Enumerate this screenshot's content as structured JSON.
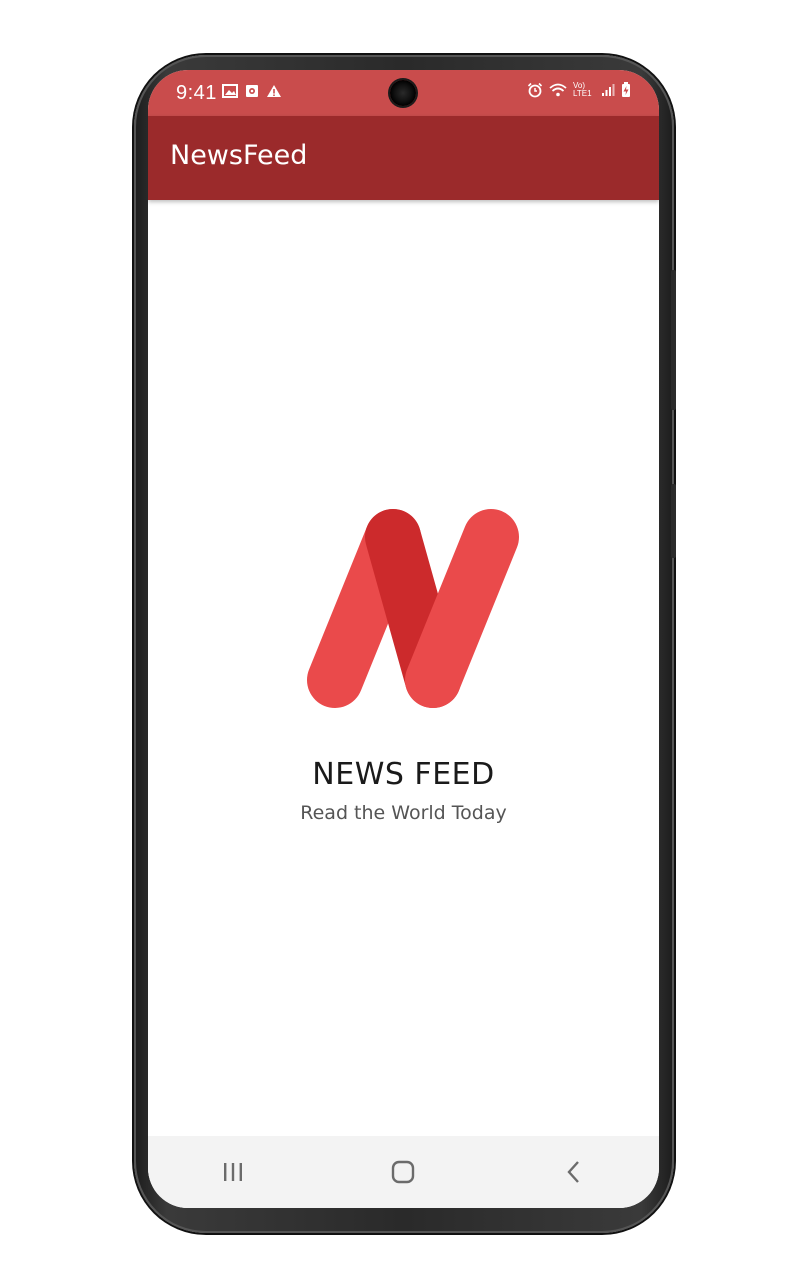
{
  "status_bar": {
    "time": "9:41",
    "left_icons": [
      "image-icon",
      "portrait-notification-icon",
      "warning-icon"
    ],
    "right_icons": [
      "alarm-icon",
      "wifi-icon",
      "volte-lte-icon",
      "signal-icon",
      "battery-charging-icon"
    ],
    "network_label": "Vo) LTE1"
  },
  "app_bar": {
    "title": "NewsFeed"
  },
  "splash": {
    "brand": "NEWS FEED",
    "tagline": "Read the World Today"
  },
  "nav_bar": {
    "buttons": [
      "recent-apps",
      "home",
      "back"
    ]
  },
  "colors": {
    "status_bar": "#c94c4c",
    "app_bar": "#9b2a2b",
    "logo_primary": "#ea4a4b",
    "logo_shadow": "#cc2a2c",
    "nav_bar": "#f3f3f3"
  }
}
